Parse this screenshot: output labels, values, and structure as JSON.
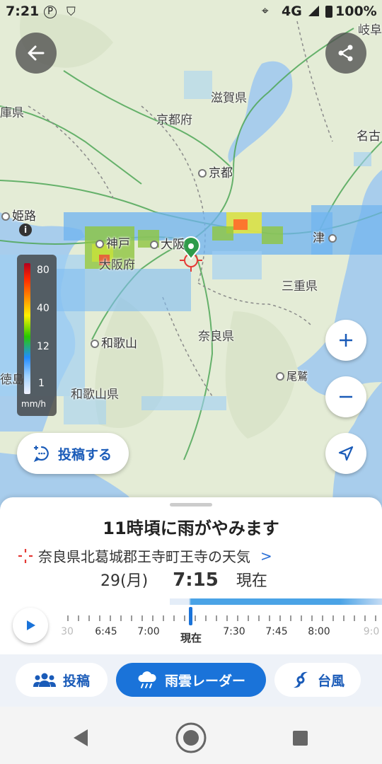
{
  "status_bar": {
    "time": "7:21",
    "network": "4G",
    "battery": "100%"
  },
  "map": {
    "prefectures": [
      {
        "id": "shiga",
        "label": "滋賀県"
      },
      {
        "id": "kyoto",
        "label": "京都府"
      },
      {
        "id": "mie",
        "label": "三重県"
      },
      {
        "id": "nara",
        "label": "奈良県"
      },
      {
        "id": "osaka",
        "label": "大阪府"
      },
      {
        "id": "wakayama",
        "label": "和歌山県"
      },
      {
        "id": "hyogo",
        "label": "庫県"
      },
      {
        "id": "gifu",
        "label": "岐阜"
      },
      {
        "id": "tokushima",
        "label": "徳島"
      }
    ],
    "cities": [
      {
        "id": "kyoto",
        "label": "京都"
      },
      {
        "id": "himeji",
        "label": "姫路"
      },
      {
        "id": "kobe",
        "label": "神戸"
      },
      {
        "id": "osaka",
        "label": "大阪"
      },
      {
        "id": "tsu",
        "label": "津"
      },
      {
        "id": "wakayama",
        "label": "和歌山"
      },
      {
        "id": "owase",
        "label": "尾鷲"
      },
      {
        "id": "nagoya",
        "label": "名古"
      }
    ]
  },
  "legend": {
    "labels": [
      "80",
      "40",
      "12",
      "1"
    ],
    "unit": "mm/h"
  },
  "buttons": {
    "post_label": "投稿する"
  },
  "sheet": {
    "headline": "11時頃に雨がやみます",
    "location": "奈良県北葛城郡王寺町王寺の天気",
    "date": "29(月)",
    "time": "7:15",
    "time_status": "現在"
  },
  "timeline": {
    "labels": [
      {
        "text": "30",
        "faded": true
      },
      {
        "text": "6:45",
        "faded": false
      },
      {
        "text": "7:00",
        "faded": false
      },
      {
        "text": "7:30",
        "faded": false
      },
      {
        "text": "7:45",
        "faded": false
      },
      {
        "text": "8:00",
        "faded": false
      },
      {
        "text": "9:0",
        "faded": true
      }
    ],
    "now_label": "現在"
  },
  "tabs": [
    {
      "label": "投稿",
      "active": false
    },
    {
      "label": "雨雲レーダー",
      "active": true
    },
    {
      "label": "台風",
      "active": false
    }
  ],
  "colors": {
    "accent": "#1a73d9",
    "sea": "#a8cdec",
    "land": "#e4ecd6",
    "pin": "#2e9b4a"
  }
}
